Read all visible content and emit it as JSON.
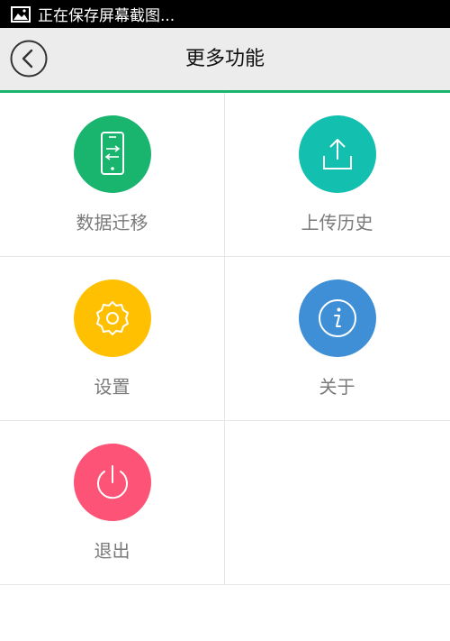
{
  "status_bar": {
    "icon": "image-icon",
    "text": "正在保存屏幕截图..."
  },
  "header": {
    "title": "更多功能",
    "back_icon": "back-arrow-icon",
    "accent_color": "#19b46e"
  },
  "menu": [
    {
      "label": "数据迁移",
      "icon": "phone-transfer-icon",
      "color": "#19b46e"
    },
    {
      "label": "上传历史",
      "icon": "upload-icon",
      "color": "#13bfae"
    },
    {
      "label": "设置",
      "icon": "gear-icon",
      "color": "#fec000"
    },
    {
      "label": "关于",
      "icon": "info-icon",
      "color": "#3f8fd6"
    },
    {
      "label": "退出",
      "icon": "power-icon",
      "color": "#fc5376"
    }
  ]
}
